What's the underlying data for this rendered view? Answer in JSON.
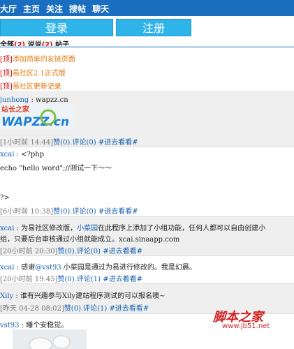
{
  "nav": [
    "大厅",
    "主页",
    "关注",
    "搜帖",
    "聊天"
  ],
  "buttons": {
    "login": "登录",
    "register": "注册"
  },
  "filter": {
    "all": "全部",
    "all_count": "(2)",
    "talk": "说说",
    "talk_count": "(2)",
    "posts": "帖子"
  },
  "pinned": [
    {
      "tag": "[顶]",
      "text": "添加简单的友链页面"
    },
    {
      "tag": "[顶]",
      "text": "易社区2.1正式版"
    },
    {
      "tag": "[顶]",
      "text": "易社区更新记录"
    }
  ],
  "posts": [
    {
      "author": "junhong",
      "sep": " : ",
      "body": "wapzz.cn",
      "meta": "[1小时前 14:44]",
      "like": "赞(0)",
      "comment": "评论(0)",
      "go": "#进去看看#",
      "logo_text": "站长之家",
      "logo_sub": "WAPZZ.cn"
    },
    {
      "author": "xcai",
      "sep": " : ",
      "lines": [
        "<?php",
        "echo \"hello word\";//测试一下～～",
        "",
        "?>"
      ],
      "meta": "[6小时前 10:38]",
      "like": "赞(0)",
      "comment": "评论(0)",
      "go": "#进去看看#"
    },
    {
      "author": "xcai",
      "sep": " : ",
      "line1_a": "为易社区修改版，",
      "line1_b": "小菜园",
      "line1_c": "在此程序上添加了小组功能，任何人都可以自由创建小",
      "line2": "组，只要后台审核通过小组就能成立。xcai.sinaapp.com",
      "meta": "[20小时前 20:30]",
      "like": "赞(0)",
      "comment": "评论(0)",
      "go": "#进去看看#"
    },
    {
      "author": "xcai",
      "sep": " : ",
      "body_a": "感谢",
      "mention": "@vst93",
      "body_b": " 小菜园是通过为易进行修改的。我是幻晨。",
      "meta": "[20小时前 19:45]",
      "like": "赞(0)",
      "comment": "评论(1)",
      "go": "#进去看看#"
    },
    {
      "author": "Xily",
      "sep": " : ",
      "body": "谁有兴趣参与Xily建站程序测试的可以报名噢~",
      "meta": "[昨天 04-28 08:02]",
      "like": "赞(0)",
      "comment": "评论(1)",
      "go": "#进去看看#"
    },
    {
      "author": "vst93",
      "sep": " : ",
      "body": "睡个安稳觉。"
    }
  ],
  "watermark": {
    "title": "脚本之家",
    "url": "www.jb51.net"
  },
  "colors": {
    "topbar": "#1a6ec0",
    "button": "#2fb4ea",
    "link": "#1560b0",
    "pinned": "#e07a10",
    "count": "#dd0000",
    "watermark": "#d31e1e"
  }
}
